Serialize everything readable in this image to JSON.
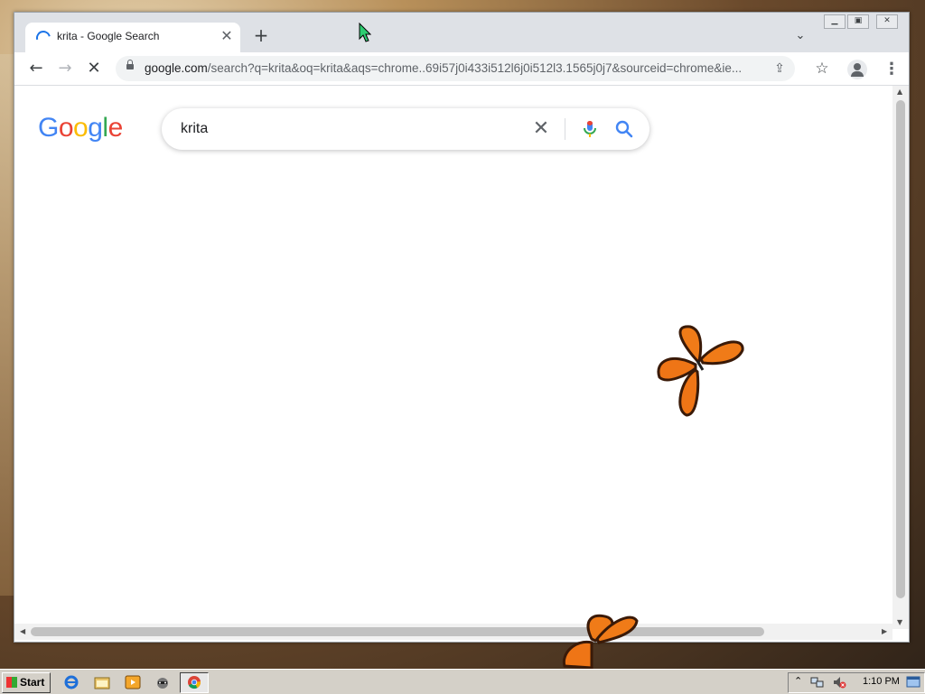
{
  "browser": {
    "tab": {
      "title": "krita - Google Search"
    },
    "address_bar": {
      "host": "google.com",
      "path": "/search?q=krita&oq=krita&aqs=chrome..69i57j0i433i512l6j0i512l3.1565j0j7&sourceid=chrome&ie..."
    }
  },
  "page": {
    "logo_text": "Google",
    "logo_colors": [
      "#4285f4",
      "#ea4335",
      "#fbbc05",
      "#4285f4",
      "#34a853",
      "#ea4335"
    ],
    "search_value": "krita"
  },
  "taskbar": {
    "start_label": "Start",
    "clock": "1:10 PM"
  },
  "colors": {
    "accent": "#1a73e8",
    "taskbar": "#d4d0c8"
  }
}
